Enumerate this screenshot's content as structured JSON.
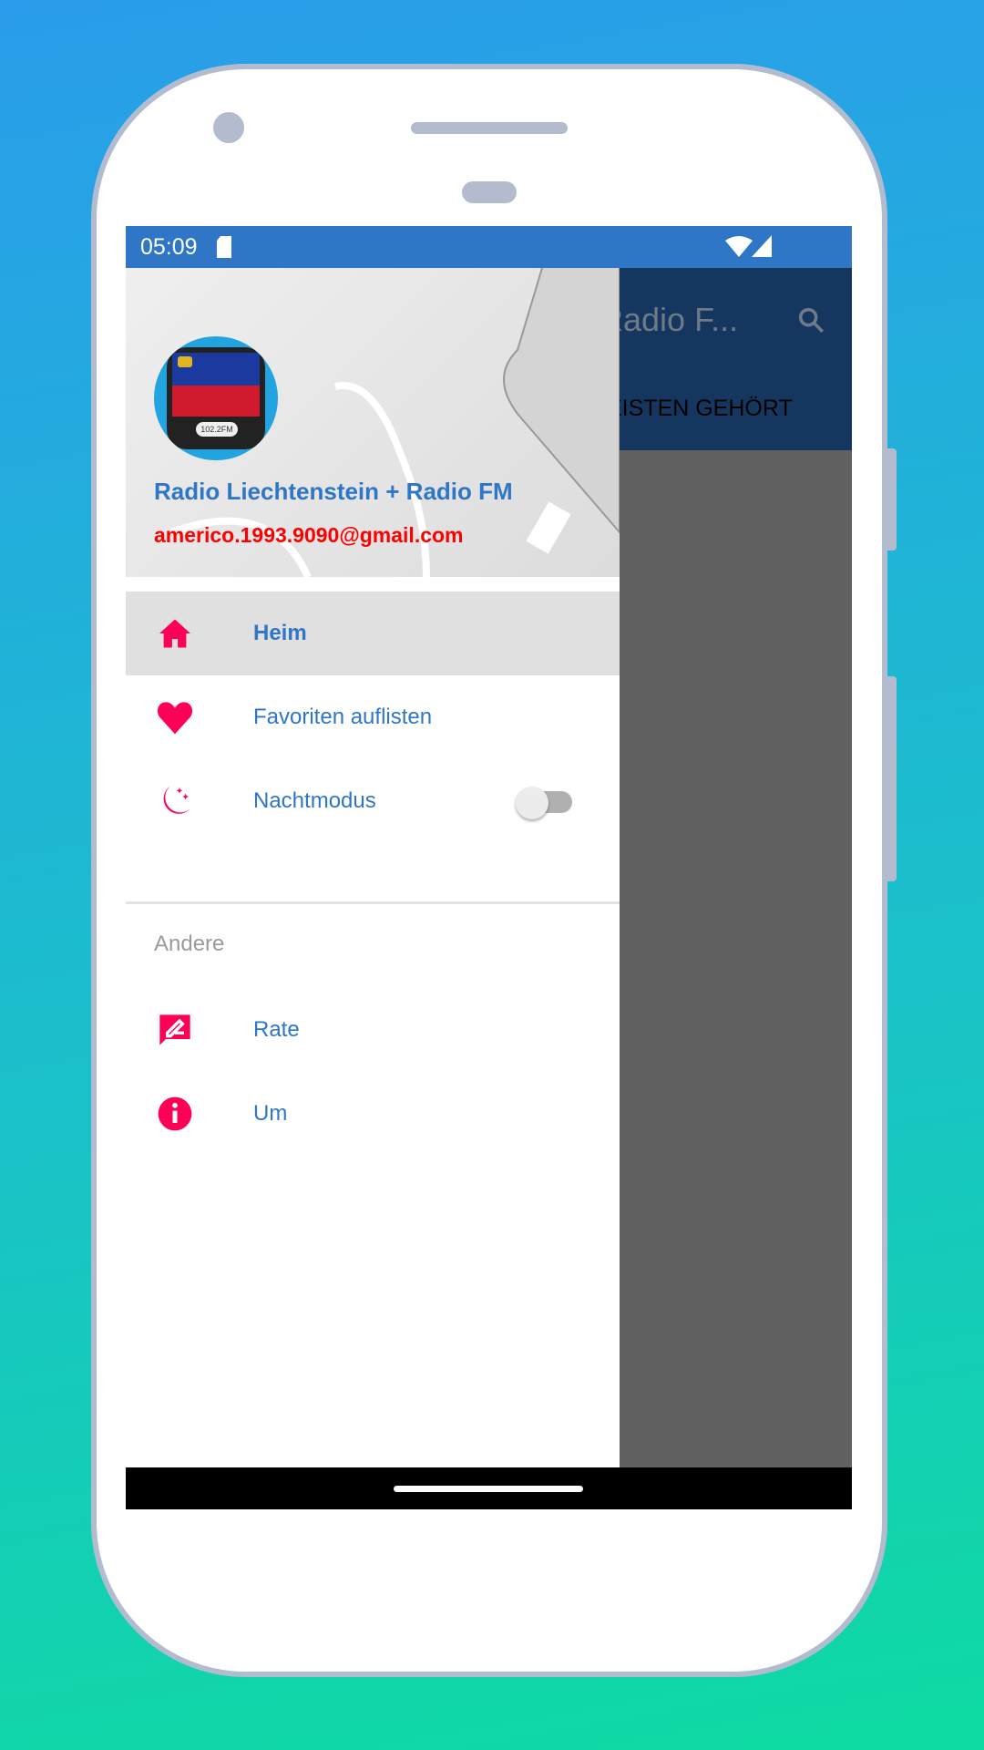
{
  "status_bar": {
    "time": "05:09",
    "icons": [
      "sd-card-icon",
      "wifi-icon",
      "signal-icon"
    ]
  },
  "app_bar": {
    "title": "Radio F...",
    "tab": "EISTEN GEHÖRT",
    "search_icon": "search-icon"
  },
  "drawer": {
    "header": {
      "title": "Radio Liechtenstein + Radio FM",
      "email": "americo.1993.9090@gmail.com",
      "avatar_frequency": "102.2FM"
    },
    "items": [
      {
        "label": "Heim",
        "icon": "home-icon",
        "selected": true
      },
      {
        "label": "Favoriten auflisten",
        "icon": "heart-icon"
      },
      {
        "label": "Nachtmodus",
        "icon": "moon-icon",
        "toggle": false
      }
    ],
    "section": "Andere",
    "other_items": [
      {
        "label": "Rate",
        "icon": "rate-icon"
      },
      {
        "label": "Um",
        "icon": "info-icon"
      }
    ]
  },
  "colors": {
    "primary": "#2f76c6",
    "accent": "#ff0058",
    "email": "#ff0000"
  }
}
